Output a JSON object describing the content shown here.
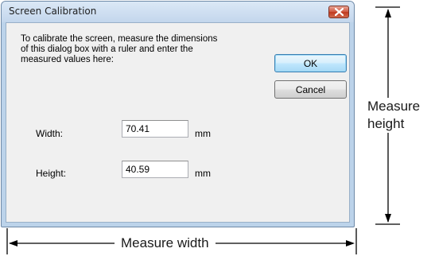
{
  "dialog": {
    "title": "Screen Calibration",
    "instruction_lines": [
      "To calibrate the screen, measure the dimensions",
      "of this dialog box with a ruler and enter the",
      "measured values here:"
    ],
    "ok_label": "OK",
    "cancel_label": "Cancel",
    "width": {
      "label": "Width:",
      "value": "70.41",
      "unit": "mm"
    },
    "height": {
      "label": "Height:",
      "value": "40.59",
      "unit": "mm"
    }
  },
  "annotations": {
    "height_label_line1": "Measure",
    "height_label_line2": "height",
    "width_label": "Measure width"
  },
  "colors": {
    "titlebar": "#c3d6ec",
    "close_button": "#c0391f",
    "client_background": "#f0f0f0",
    "default_button_border": "#3c7fb1"
  }
}
